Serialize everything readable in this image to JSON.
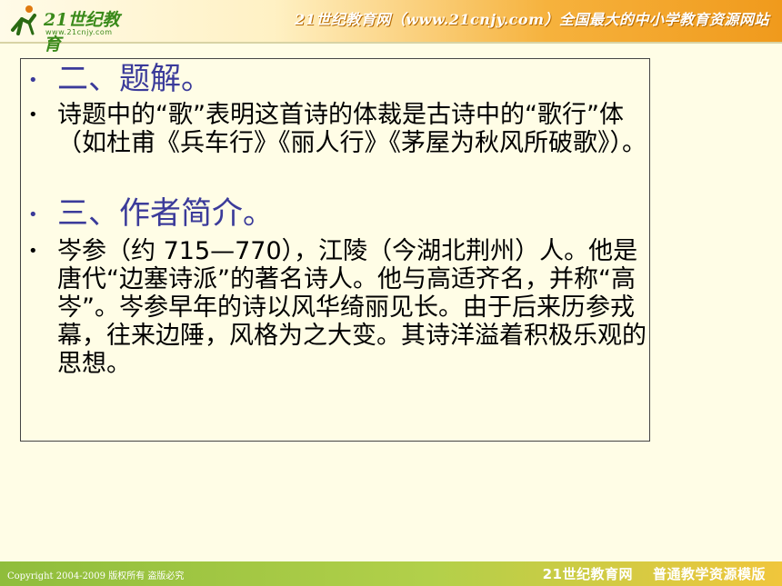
{
  "header": {
    "logo_text": "21世纪教育",
    "logo_url": "www.21cnjy.com",
    "slogan": "21世纪教育网（www.21cnjy.com）全国最大的中小学教育资源网站"
  },
  "content": {
    "items": [
      {
        "type": "heading",
        "text": "二、题解。"
      },
      {
        "type": "paragraph",
        "text": "诗题中的“歌”表明这首诗的体裁是古诗中的“歌行”体（如杜甫《兵车行》《丽人行》《茅屋为秋风所破歌》）。"
      },
      {
        "type": "heading",
        "text": "三、作者简介。"
      },
      {
        "type": "paragraph",
        "text": "岑参（约 715—770），江陵（今湖北荆州）人。他是唐代“边塞诗派”的著名诗人。他与高适齐名，并称“高岑”。岑参早年的诗以风华绮丽见长。由于后来历参戎幕，往来边陲，风格为之大变。其诗洋溢着积极乐观的思想。"
      }
    ]
  },
  "footer": {
    "copyright": "Copyright 2004-2009 版权所有 盗版必究",
    "site_name": "21世纪教育网",
    "template_label": "普通教学资源模版"
  },
  "colors": {
    "heading": "#3b3b9a",
    "heading_bullet": "#3b3b9a",
    "body_text": "#000000",
    "page_background": "#fffde6"
  }
}
